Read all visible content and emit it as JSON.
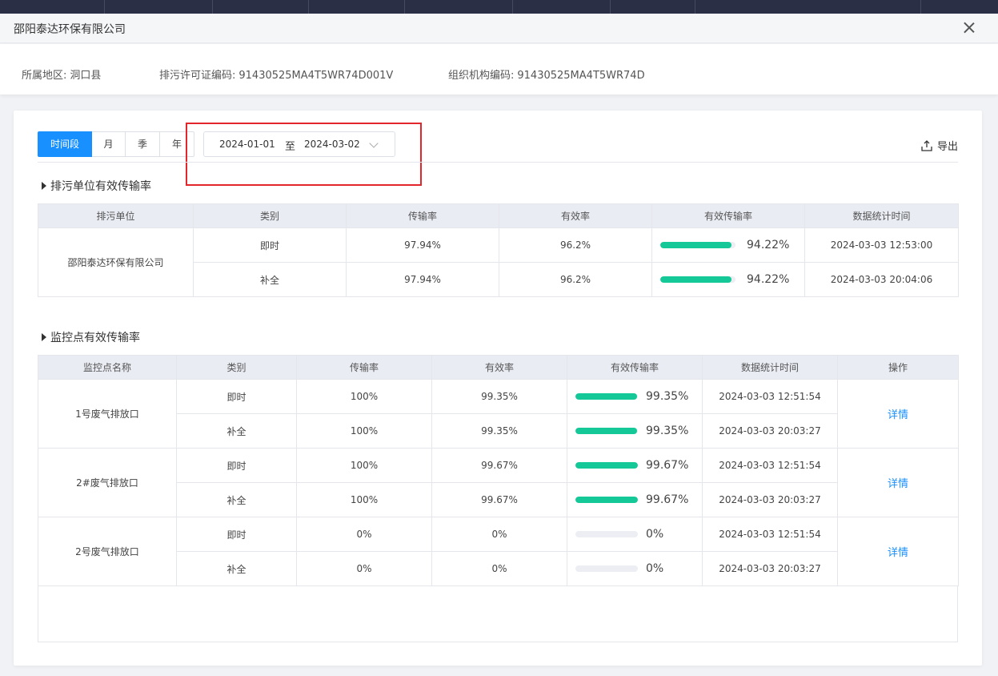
{
  "modal": {
    "title": "邵阳泰达环保有限公司"
  },
  "info": {
    "region_label": "所属地区:",
    "region_value": "洞口县",
    "permit_label": "排污许可证编码:",
    "permit_value": "91430525MA4T5WR74D001V",
    "org_label": "组织机构编码:",
    "org_value": "91430525MA4T5WR74D"
  },
  "filter": {
    "tabs": [
      "时间段",
      "月",
      "季",
      "年"
    ],
    "active_tab": "时间段",
    "start_date": "2024-01-01",
    "separator": "至",
    "end_date": "2024-03-02",
    "export_label": "导出"
  },
  "unit_section": {
    "title": "排污单位有效传输率",
    "headers": [
      "排污单位",
      "类别",
      "传输率",
      "有效率",
      "有效传输率",
      "数据统计时间"
    ],
    "unit_name": "邵阳泰达环保有限公司",
    "rows": [
      {
        "type": "即时",
        "transmission": "97.94%",
        "valid": "96.2%",
        "effective": "94.22%",
        "effective_value": 94.22,
        "time": "2024-03-03 12:53:00"
      },
      {
        "type": "补全",
        "transmission": "97.94%",
        "valid": "96.2%",
        "effective": "94.22%",
        "effective_value": 94.22,
        "time": "2024-03-03 20:04:06"
      }
    ]
  },
  "monitor_section": {
    "title": "监控点有效传输率",
    "headers": [
      "监控点名称",
      "类别",
      "传输率",
      "有效率",
      "有效传输率",
      "数据统计时间",
      "操作"
    ],
    "action_label": "详情",
    "points": [
      {
        "name": "1号废气排放口",
        "rows": [
          {
            "type": "即时",
            "transmission": "100%",
            "valid": "99.35%",
            "effective": "99.35%",
            "effective_value": 99.35,
            "time": "2024-03-03 12:51:54"
          },
          {
            "type": "补全",
            "transmission": "100%",
            "valid": "99.35%",
            "effective": "99.35%",
            "effective_value": 99.35,
            "time": "2024-03-03 20:03:27"
          }
        ]
      },
      {
        "name": "2#废气排放口",
        "rows": [
          {
            "type": "即时",
            "transmission": "100%",
            "valid": "99.67%",
            "effective": "99.67%",
            "effective_value": 99.67,
            "time": "2024-03-03 12:51:54"
          },
          {
            "type": "补全",
            "transmission": "100%",
            "valid": "99.67%",
            "effective": "99.67%",
            "effective_value": 99.67,
            "time": "2024-03-03 20:03:27"
          }
        ]
      },
      {
        "name": "2号废气排放口",
        "rows": [
          {
            "type": "即时",
            "transmission": "0%",
            "valid": "0%",
            "effective": "0%",
            "effective_value": 0,
            "time": "2024-03-03 12:51:54"
          },
          {
            "type": "补全",
            "transmission": "0%",
            "valid": "0%",
            "effective": "0%",
            "effective_value": 0,
            "time": "2024-03-03 20:03:27"
          }
        ]
      }
    ]
  },
  "colors": {
    "accent": "#1890ff",
    "progress": "#14c997",
    "highlight": "#e3262c",
    "header_bg": "#e9ecf3"
  }
}
